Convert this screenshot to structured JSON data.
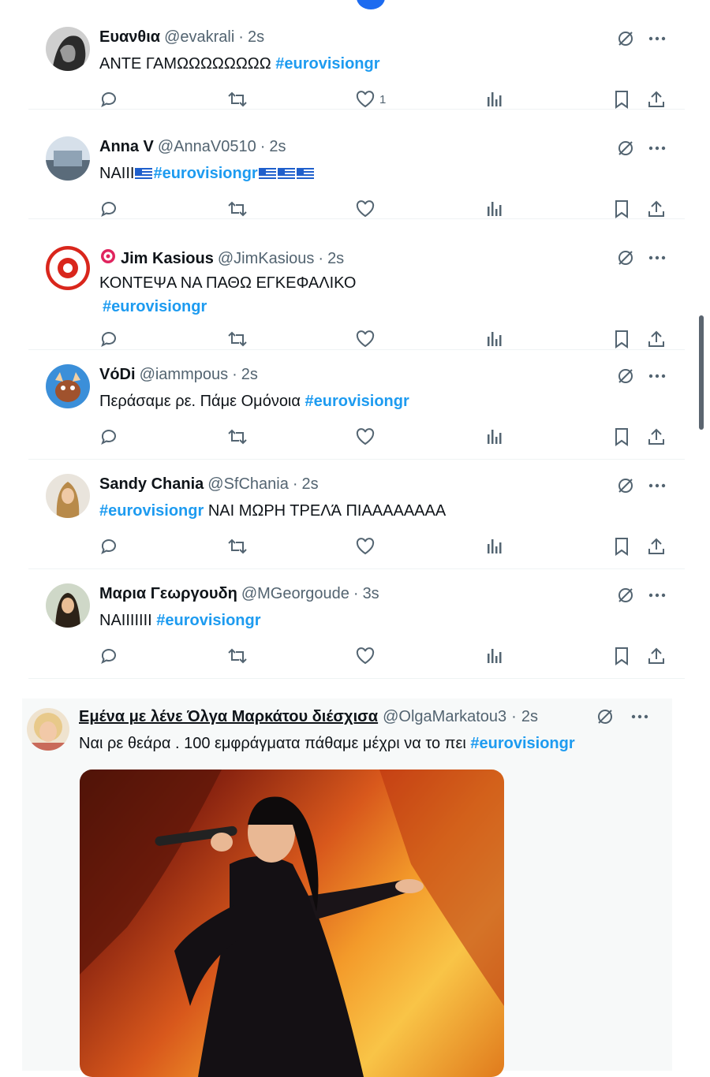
{
  "tweets": [
    {
      "name": "Ευανθια",
      "handle": "@evakrali",
      "time": "2s",
      "text_before": "ΑΝΤΕ ΓΑΜΩΩΩΩΩΩΩΩ ",
      "hashtag": "#eurovisiongr",
      "text_after": "",
      "likes": "1"
    },
    {
      "name": "Anna V",
      "handle": "@AnnaV0510",
      "time": "2s",
      "text_before": "ΝΑΙΙΙ",
      "hashtag": "#eurovisiongr",
      "text_after": "",
      "likes": ""
    },
    {
      "name": "Jim Kasious",
      "handle": "@JimKasious",
      "time": "2s",
      "text_before": "ΚΟΝΤΕΨΑ ΝΑ ΠΑΘΩ ΕΓΚΕΦΑΛΙΚΟ",
      "hashtag": "#eurovisiongr",
      "text_after": "",
      "likes": ""
    },
    {
      "name": "VόDi",
      "handle": "@iammpous",
      "time": "2s",
      "text_before": "Περάσαμε ρε. Πάμε Ομόνοια ",
      "hashtag": "#eurovisiongr",
      "text_after": "",
      "likes": ""
    },
    {
      "name": "Sandy Chania",
      "handle": "@SfChania",
      "time": "2s",
      "text_before": "",
      "hashtag": "#eurovisiongr",
      "text_after": " ΝΑΙ ΜΩΡΗ ΤΡΕΛΆ ΠΙΑΑΑΑΑΑΑΑ",
      "likes": ""
    },
    {
      "name": "Μαρια Γεωργουδη",
      "handle": "@MGeorgoude",
      "time": "3s",
      "text_before": "ΝΑΙΙΙΙΙΙΙ ",
      "hashtag": "#eurovisiongr",
      "text_after": "",
      "likes": ""
    }
  ],
  "quote": {
    "name": "Εμένα με λένε Όλγα Μαρκάτου διέσχισα",
    "handle": "@OlgaMarkatou3",
    "time": "2s",
    "text_before": "Ναι ρε θεάρα . 100 εμφράγματα πάθαμε μέχρι να το πει ",
    "hashtag": "#eurovisiongr"
  },
  "separator": "·",
  "colors": {
    "accent": "#1d9bf0",
    "muted": "#536471",
    "border": "#eff3f4"
  }
}
